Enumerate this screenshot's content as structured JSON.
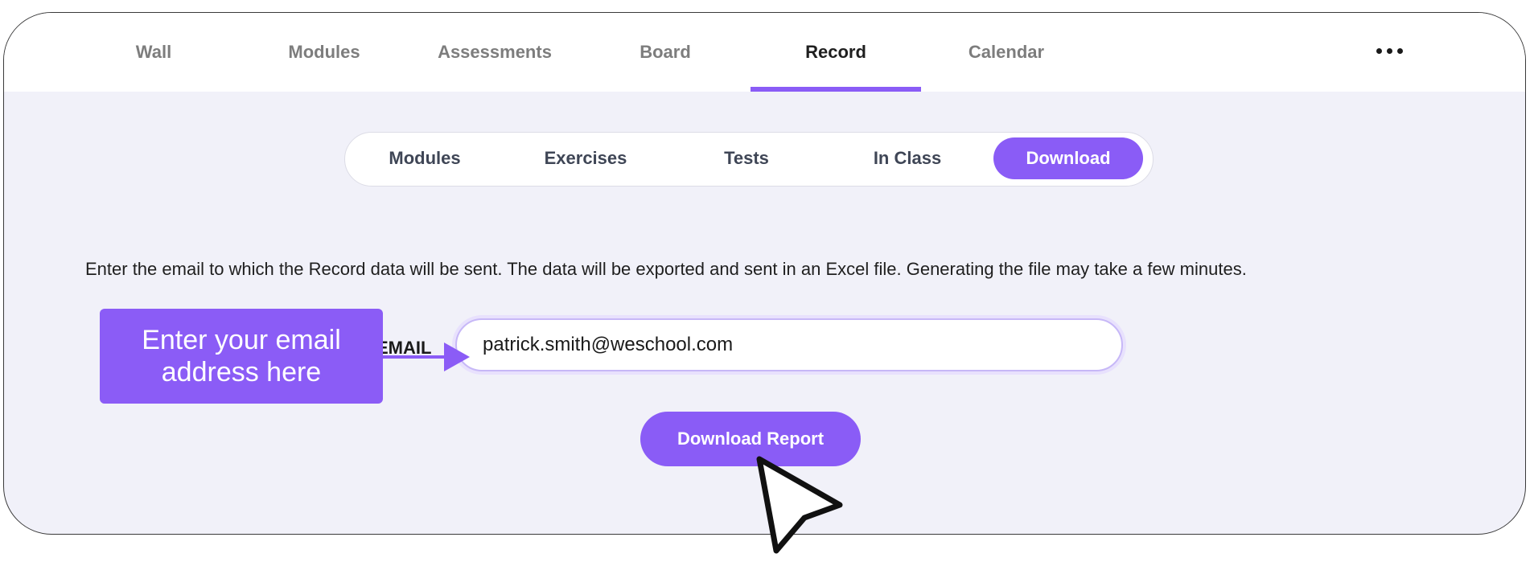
{
  "topnav": {
    "tabs": [
      "Wall",
      "Modules",
      "Assessments",
      "Board",
      "Record",
      "Calendar"
    ],
    "active": "Record"
  },
  "subnav": {
    "tabs": [
      "Modules",
      "Exercises",
      "Tests",
      "In Class",
      "Download"
    ],
    "active": "Download"
  },
  "description": "Enter the email to which the Record data will be sent. The data will be exported and sent in an Excel file. Generating the file may take a few minutes.",
  "email": {
    "label": "EMAIL",
    "value": "patrick.smith@weschool.com"
  },
  "download_button": "Download Report",
  "callout": "Enter your email address here",
  "colors": {
    "accent": "#8a5cf6",
    "background": "#f1f1f9"
  },
  "icons": [
    "more-horizontal-icon",
    "cursor-icon",
    "arrow-right-icon"
  ]
}
